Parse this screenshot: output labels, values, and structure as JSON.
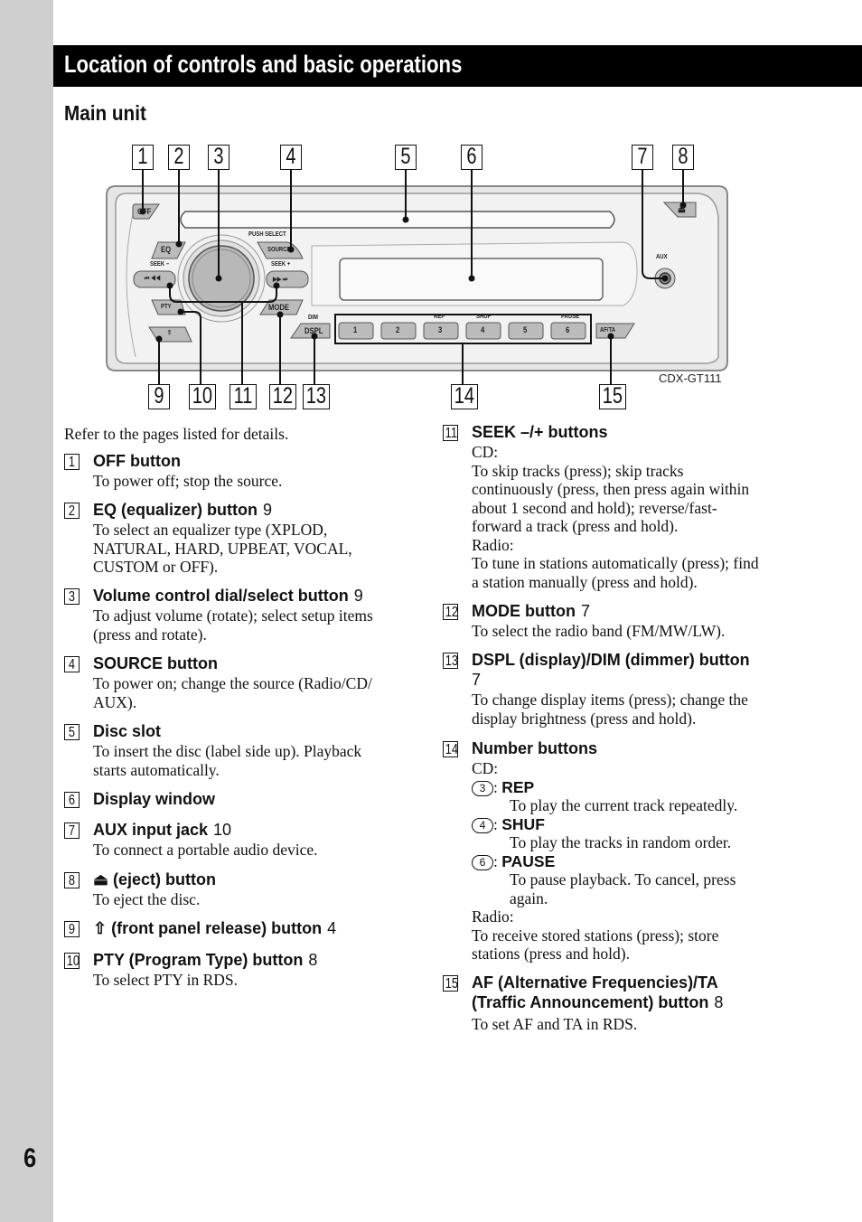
{
  "page": {
    "section_title": "Location of controls and basic operations",
    "subheading": "Main unit",
    "page_number": "6",
    "intro": "Refer to the pages listed for details."
  },
  "diagram": {
    "model": "CDX-GT111",
    "callouts": [
      "1",
      "2",
      "3",
      "4",
      "5",
      "6",
      "7",
      "8",
      "9",
      "10",
      "11",
      "12",
      "13",
      "14",
      "15"
    ],
    "unit_labels": {
      "off": "OFF",
      "eq": "EQ",
      "push_select": "PUSH SELECT",
      "source": "SOURCE",
      "seek_minus": "SEEK –",
      "seek_plus": "SEEK +",
      "seek_minus_glyph": "⏮ ◀◀",
      "seek_plus_glyph": "▶▶ ⏭",
      "pty": "PTY",
      "mode": "MODE",
      "dim": "DIM",
      "dspl": "DSPL",
      "aux": "AUX",
      "af_ta": "AF/TA",
      "eject_glyph": "⏏",
      "release_glyph": "⇧",
      "presets": [
        {
          "label": "1",
          "top": ""
        },
        {
          "label": "2",
          "top": ""
        },
        {
          "label": "3",
          "top": "REP"
        },
        {
          "label": "4",
          "top": "SHUF"
        },
        {
          "label": "5",
          "top": ""
        },
        {
          "label": "6",
          "top": "PAUSE"
        }
      ]
    }
  },
  "items": [
    {
      "num": "1",
      "title": "OFF button",
      "page": "",
      "desc": [
        "To power off; stop the source."
      ]
    },
    {
      "num": "2",
      "title": "EQ (equalizer) button",
      "page": "9",
      "desc": [
        "To select an equalizer type (XPLOD,",
        "NATURAL, HARD, UPBEAT, VOCAL,",
        "CUSTOM or OFF)."
      ]
    },
    {
      "num": "3",
      "title": "Volume control dial/select button",
      "page": "9",
      "desc": [
        "To adjust volume (rotate); select setup items",
        "(press and rotate)."
      ]
    },
    {
      "num": "4",
      "title": "SOURCE button",
      "page": "",
      "desc": [
        "To power on; change the source (Radio/CD/",
        "AUX)."
      ]
    },
    {
      "num": "5",
      "title": "Disc slot",
      "page": "",
      "desc": [
        "To insert the disc (label side up). Playback",
        "starts automatically."
      ]
    },
    {
      "num": "6",
      "title": "Display window",
      "page": "",
      "desc": []
    },
    {
      "num": "7",
      "title": "AUX input jack",
      "page": "10",
      "desc": [
        "To connect a portable audio device."
      ]
    },
    {
      "num": "8",
      "title": "⏏ (eject) button",
      "page": "",
      "desc": [
        "To eject the disc."
      ]
    },
    {
      "num": "9",
      "title": "(front panel release) button",
      "page": "4",
      "desc": []
    },
    {
      "num": "10",
      "title": "PTY (Program Type) button",
      "page": "8",
      "desc": [
        "To select PTY in RDS."
      ]
    },
    {
      "num": "11",
      "title": "SEEK –/+ buttons",
      "page": "",
      "desc": [
        "CD:",
        "To skip tracks (press); skip tracks",
        "continuously (press, then press again within",
        "about 1 second and hold); reverse/fast-",
        "forward a track (press and hold).",
        "Radio:",
        "To tune in stations automatically (press); find",
        "a station manually (press and hold)."
      ]
    },
    {
      "num": "12",
      "title": "MODE button",
      "page": "7",
      "desc": [
        "To select the radio band (FM/MW/LW)."
      ]
    },
    {
      "num": "13",
      "title": "DSPL (display)/DIM (dimmer) button",
      "page": "7",
      "desc": [
        "To change display items (press); change the",
        "display brightness (press and hold)."
      ]
    },
    {
      "num": "14",
      "title": "Number buttons",
      "page": "",
      "cd_label": "CD:",
      "subs": [
        {
          "circle": "3",
          "name": "REP",
          "desc": "To play the current track repeatedly."
        },
        {
          "circle": "4",
          "name": "SHUF",
          "desc": "To play the tracks in random order."
        },
        {
          "circle": "6",
          "name": "PAUSE",
          "desc": [
            "To pause playback. To cancel, press",
            "again."
          ]
        }
      ],
      "radio_label": "Radio:",
      "radio_desc": [
        "To receive stored stations (press); store",
        "stations (press and hold)."
      ]
    },
    {
      "num": "15",
      "title": "AF (Alternative Frequencies)/TA",
      "title2": "(Traffic Announcement) button",
      "page": "8",
      "desc": [
        "To set AF and TA in RDS."
      ]
    }
  ]
}
